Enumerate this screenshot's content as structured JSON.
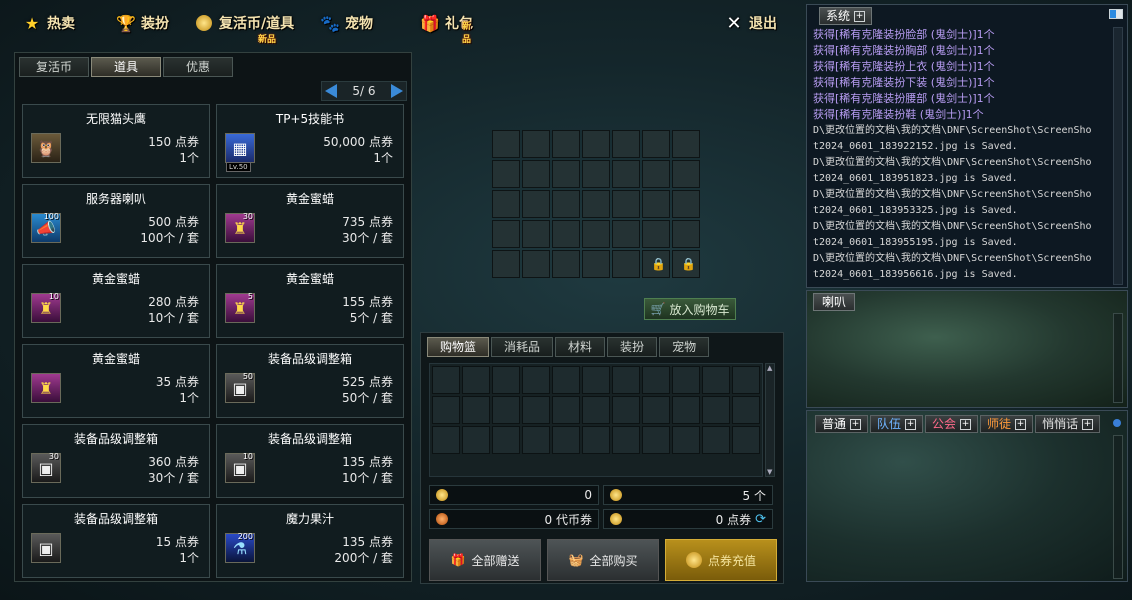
{
  "top_menu": {
    "tabs": [
      {
        "label": "热卖",
        "icon": "star-icon",
        "badge": ""
      },
      {
        "label": "装扮",
        "icon": "trophy-icon",
        "badge": ""
      },
      {
        "label": "复活币/道具",
        "icon": "coin-icon",
        "badge": "新品"
      },
      {
        "label": "宠物",
        "icon": "paw-icon",
        "badge": ""
      },
      {
        "label": "礼包",
        "icon": "gift-icon",
        "badge": "新品"
      }
    ],
    "exit_label": "退出"
  },
  "left_panel": {
    "subtabs": [
      "复活币",
      "道具",
      "优惠"
    ],
    "active_subtab": "道具",
    "page_indicator": "5/ 6",
    "items": [
      {
        "name": "无限猫头鹰",
        "price": "150 点券",
        "unit": "1个",
        "icon": "owl-icon",
        "qty": ""
      },
      {
        "name": "TP+5技能书",
        "price": "50,000 点券",
        "unit": "1个",
        "icon": "skill-book-icon",
        "qty": "",
        "level": "Lv.50"
      },
      {
        "name": "服务器喇叭",
        "price": "500 点券",
        "unit": "100个 / 套",
        "icon": "horn-icon",
        "qty": "100"
      },
      {
        "name": "黄金蜜蜡",
        "price": "735 点券",
        "unit": "30个 / 套",
        "icon": "gold-wax-icon",
        "qty": "30"
      },
      {
        "name": "黄金蜜蜡",
        "price": "280 点券",
        "unit": "10个 / 套",
        "icon": "gold-wax-icon",
        "qty": "10"
      },
      {
        "name": "黄金蜜蜡",
        "price": "155 点券",
        "unit": "5个 / 套",
        "icon": "gold-wax-icon",
        "qty": "5"
      },
      {
        "name": "黄金蜜蜡",
        "price": "35 点券",
        "unit": "1个",
        "icon": "gold-wax-icon",
        "qty": ""
      },
      {
        "name": "装备品级调整箱",
        "price": "525 点券",
        "unit": "50个 / 套",
        "icon": "grade-box-icon",
        "qty": "50"
      },
      {
        "name": "装备品级调整箱",
        "price": "360 点券",
        "unit": "30个 / 套",
        "icon": "grade-box-icon",
        "qty": "30"
      },
      {
        "name": "装备品级调整箱",
        "price": "135 点券",
        "unit": "10个 / 套",
        "icon": "grade-box-icon",
        "qty": "10"
      },
      {
        "name": "装备品级调整箱",
        "price": "15 点券",
        "unit": "1个",
        "icon": "grade-box-icon",
        "qty": ""
      },
      {
        "name": "魔力果汁",
        "price": "135 点券",
        "unit": "200个 / 套",
        "icon": "magic-juice-icon",
        "qty": "200"
      }
    ]
  },
  "preview": {
    "add_to_cart_label": "放入购物车"
  },
  "basket": {
    "tabs": [
      "购物篮",
      "消耗品",
      "材料",
      "装扮",
      "宠物"
    ],
    "active_tab": "购物篮",
    "stats": {
      "gold_value": "0",
      "coin_count": "5 个",
      "revive_coin": "0 代币券",
      "points": "0 点券"
    },
    "gift_all_label": "全部赠送",
    "buy_all_label": "全部购买",
    "recharge_label": "点券充值"
  },
  "system": {
    "title": "系统",
    "purple_lines": [
      "获得[稀有克隆装扮脸部 (鬼剑士)]1个",
      "获得[稀有克隆装扮胸部 (鬼剑士)]1个",
      "获得[稀有克隆装扮上衣 (鬼剑士)]1个",
      "获得[稀有克隆装扮下装 (鬼剑士)]1个",
      "获得[稀有克隆装扮腰部 (鬼剑士)]1个",
      "获得[稀有克隆装扮鞋 (鬼剑士)]1个"
    ],
    "save_lines": [
      "D\\更改位置的文档\\我的文档\\DNF\\ScreenShot\\ScreenSho",
      "t2024_0601_183922152.jpg is Saved.",
      "D\\更改位置的文档\\我的文档\\DNF\\ScreenShot\\ScreenSho",
      "t2024_0601_183951823.jpg is Saved.",
      "D\\更改位置的文档\\我的文档\\DNF\\ScreenShot\\ScreenSho",
      "t2024_0601_183953325.jpg is Saved.",
      "D\\更改位置的文档\\我的文档\\DNF\\ScreenShot\\ScreenSho",
      "t2024_0601_183955195.jpg is Saved.",
      "D\\更改位置的文档\\我的文档\\DNF\\ScreenShot\\ScreenSho",
      "t2024_0601_183956616.jpg is Saved."
    ]
  },
  "horn_panel": {
    "title": "喇叭"
  },
  "chat": {
    "tabs": [
      {
        "label": "普通",
        "color": "#ffffff"
      },
      {
        "label": "队伍",
        "color": "#6fb4ff"
      },
      {
        "label": "公会",
        "color": "#ff6a8a"
      },
      {
        "label": "师徒",
        "color": "#ff9a3a"
      },
      {
        "label": "悄悄话",
        "color": "#e0e0e0"
      }
    ]
  },
  "colors": {
    "accent_gold": "#b8901c",
    "log_purple": "#b79cf2",
    "pager_blue": "#3a8ad8"
  }
}
